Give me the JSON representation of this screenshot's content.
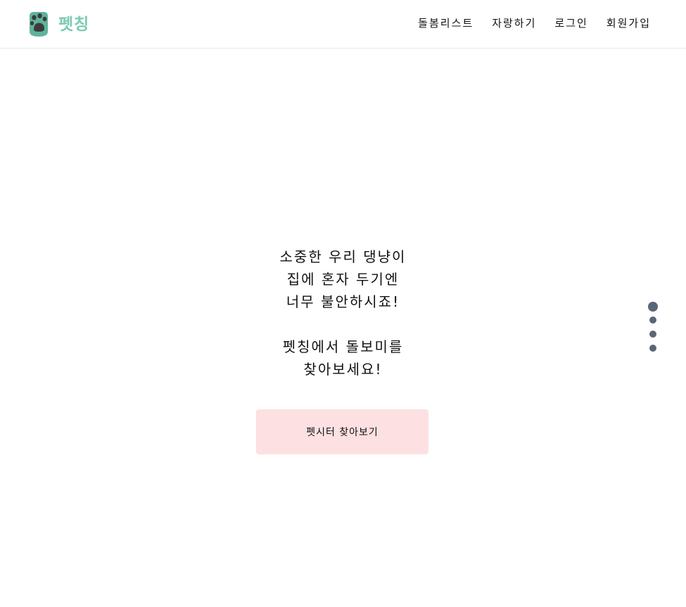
{
  "brand": {
    "name": "펫칭",
    "icon": "paw-icon",
    "color": "#7bcbb4",
    "icon_bg": "#5fb39c",
    "icon_fg": "#3b3b3b"
  },
  "nav": {
    "items": [
      {
        "label": "돌봄리스트"
      },
      {
        "label": "자랑하기"
      },
      {
        "label": "로그인"
      },
      {
        "label": "회원가입"
      }
    ]
  },
  "hero": {
    "lines_1": [
      "소중한 우리 댕냥이",
      "집에 혼자 두기엔",
      "너무 불안하시죠!"
    ],
    "lines_2": [
      "펫칭에서 돌보미를",
      "찾아보세요!"
    ]
  },
  "cta": {
    "label": "펫시터 찾아보기",
    "bg": "#fde0e2"
  },
  "pagination": {
    "count": 4,
    "active_index": 0,
    "color": "#5a6577"
  }
}
